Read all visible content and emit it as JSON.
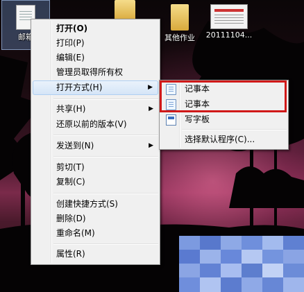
{
  "desktop": {
    "icons": [
      {
        "label": "邮箱",
        "kind": "document"
      },
      {
        "label": "",
        "kind": "folder"
      },
      {
        "label": "其他作业",
        "kind": "folder"
      },
      {
        "label": "20111104...",
        "kind": "image-thumbnail"
      }
    ]
  },
  "context_menu": {
    "items": [
      {
        "label": "打开(O)",
        "bold": true
      },
      {
        "label": "打印(P)"
      },
      {
        "label": "编辑(E)"
      },
      {
        "label": "管理员取得所有权"
      },
      {
        "label": "打开方式(H)",
        "has_submenu": true,
        "highlighted": true
      },
      {
        "label": "共享(H)",
        "has_submenu": true
      },
      {
        "label": "还原以前的版本(V)"
      },
      {
        "label": "发送到(N)",
        "has_submenu": true
      },
      {
        "label": "剪切(T)"
      },
      {
        "label": "复制(C)"
      },
      {
        "label": "创建快捷方式(S)"
      },
      {
        "label": "删除(D)"
      },
      {
        "label": "重命名(M)"
      },
      {
        "label": "属性(R)"
      }
    ],
    "submenu_arrow": "▶"
  },
  "open_with_submenu": {
    "items": [
      {
        "label": "记事本",
        "icon": "notepad-icon"
      },
      {
        "label": "记事本",
        "icon": "notepad-icon"
      },
      {
        "label": "写字板",
        "icon": "wordpad-icon"
      },
      {
        "label": "选择默认程序(C)..."
      }
    ]
  },
  "colors": {
    "menu_bg": "#f0f0f0",
    "highlight_border": "#d01818",
    "hover_bg": "#d5e5f7"
  }
}
